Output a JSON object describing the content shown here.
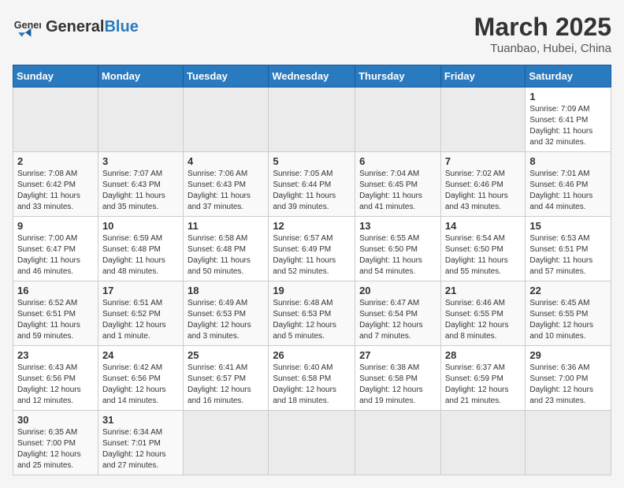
{
  "header": {
    "logo_general": "General",
    "logo_blue": "Blue",
    "month": "March 2025",
    "location": "Tuanbao, Hubei, China"
  },
  "weekdays": [
    "Sunday",
    "Monday",
    "Tuesday",
    "Wednesday",
    "Thursday",
    "Friday",
    "Saturday"
  ],
  "weeks": [
    [
      {
        "day": "",
        "info": ""
      },
      {
        "day": "",
        "info": ""
      },
      {
        "day": "",
        "info": ""
      },
      {
        "day": "",
        "info": ""
      },
      {
        "day": "",
        "info": ""
      },
      {
        "day": "",
        "info": ""
      },
      {
        "day": "1",
        "info": "Sunrise: 7:09 AM\nSunset: 6:41 PM\nDaylight: 11 hours\nand 32 minutes."
      }
    ],
    [
      {
        "day": "2",
        "info": "Sunrise: 7:08 AM\nSunset: 6:42 PM\nDaylight: 11 hours\nand 33 minutes."
      },
      {
        "day": "3",
        "info": "Sunrise: 7:07 AM\nSunset: 6:43 PM\nDaylight: 11 hours\nand 35 minutes."
      },
      {
        "day": "4",
        "info": "Sunrise: 7:06 AM\nSunset: 6:43 PM\nDaylight: 11 hours\nand 37 minutes."
      },
      {
        "day": "5",
        "info": "Sunrise: 7:05 AM\nSunset: 6:44 PM\nDaylight: 11 hours\nand 39 minutes."
      },
      {
        "day": "6",
        "info": "Sunrise: 7:04 AM\nSunset: 6:45 PM\nDaylight: 11 hours\nand 41 minutes."
      },
      {
        "day": "7",
        "info": "Sunrise: 7:02 AM\nSunset: 6:46 PM\nDaylight: 11 hours\nand 43 minutes."
      },
      {
        "day": "8",
        "info": "Sunrise: 7:01 AM\nSunset: 6:46 PM\nDaylight: 11 hours\nand 44 minutes."
      }
    ],
    [
      {
        "day": "9",
        "info": "Sunrise: 7:00 AM\nSunset: 6:47 PM\nDaylight: 11 hours\nand 46 minutes."
      },
      {
        "day": "10",
        "info": "Sunrise: 6:59 AM\nSunset: 6:48 PM\nDaylight: 11 hours\nand 48 minutes."
      },
      {
        "day": "11",
        "info": "Sunrise: 6:58 AM\nSunset: 6:48 PM\nDaylight: 11 hours\nand 50 minutes."
      },
      {
        "day": "12",
        "info": "Sunrise: 6:57 AM\nSunset: 6:49 PM\nDaylight: 11 hours\nand 52 minutes."
      },
      {
        "day": "13",
        "info": "Sunrise: 6:55 AM\nSunset: 6:50 PM\nDaylight: 11 hours\nand 54 minutes."
      },
      {
        "day": "14",
        "info": "Sunrise: 6:54 AM\nSunset: 6:50 PM\nDaylight: 11 hours\nand 55 minutes."
      },
      {
        "day": "15",
        "info": "Sunrise: 6:53 AM\nSunset: 6:51 PM\nDaylight: 11 hours\nand 57 minutes."
      }
    ],
    [
      {
        "day": "16",
        "info": "Sunrise: 6:52 AM\nSunset: 6:51 PM\nDaylight: 11 hours\nand 59 minutes."
      },
      {
        "day": "17",
        "info": "Sunrise: 6:51 AM\nSunset: 6:52 PM\nDaylight: 12 hours\nand 1 minute."
      },
      {
        "day": "18",
        "info": "Sunrise: 6:49 AM\nSunset: 6:53 PM\nDaylight: 12 hours\nand 3 minutes."
      },
      {
        "day": "19",
        "info": "Sunrise: 6:48 AM\nSunset: 6:53 PM\nDaylight: 12 hours\nand 5 minutes."
      },
      {
        "day": "20",
        "info": "Sunrise: 6:47 AM\nSunset: 6:54 PM\nDaylight: 12 hours\nand 7 minutes."
      },
      {
        "day": "21",
        "info": "Sunrise: 6:46 AM\nSunset: 6:55 PM\nDaylight: 12 hours\nand 8 minutes."
      },
      {
        "day": "22",
        "info": "Sunrise: 6:45 AM\nSunset: 6:55 PM\nDaylight: 12 hours\nand 10 minutes."
      }
    ],
    [
      {
        "day": "23",
        "info": "Sunrise: 6:43 AM\nSunset: 6:56 PM\nDaylight: 12 hours\nand 12 minutes."
      },
      {
        "day": "24",
        "info": "Sunrise: 6:42 AM\nSunset: 6:56 PM\nDaylight: 12 hours\nand 14 minutes."
      },
      {
        "day": "25",
        "info": "Sunrise: 6:41 AM\nSunset: 6:57 PM\nDaylight: 12 hours\nand 16 minutes."
      },
      {
        "day": "26",
        "info": "Sunrise: 6:40 AM\nSunset: 6:58 PM\nDaylight: 12 hours\nand 18 minutes."
      },
      {
        "day": "27",
        "info": "Sunrise: 6:38 AM\nSunset: 6:58 PM\nDaylight: 12 hours\nand 19 minutes."
      },
      {
        "day": "28",
        "info": "Sunrise: 6:37 AM\nSunset: 6:59 PM\nDaylight: 12 hours\nand 21 minutes."
      },
      {
        "day": "29",
        "info": "Sunrise: 6:36 AM\nSunset: 7:00 PM\nDaylight: 12 hours\nand 23 minutes."
      }
    ],
    [
      {
        "day": "30",
        "info": "Sunrise: 6:35 AM\nSunset: 7:00 PM\nDaylight: 12 hours\nand 25 minutes."
      },
      {
        "day": "31",
        "info": "Sunrise: 6:34 AM\nSunset: 7:01 PM\nDaylight: 12 hours\nand 27 minutes."
      },
      {
        "day": "",
        "info": ""
      },
      {
        "day": "",
        "info": ""
      },
      {
        "day": "",
        "info": ""
      },
      {
        "day": "",
        "info": ""
      },
      {
        "day": "",
        "info": ""
      }
    ]
  ]
}
